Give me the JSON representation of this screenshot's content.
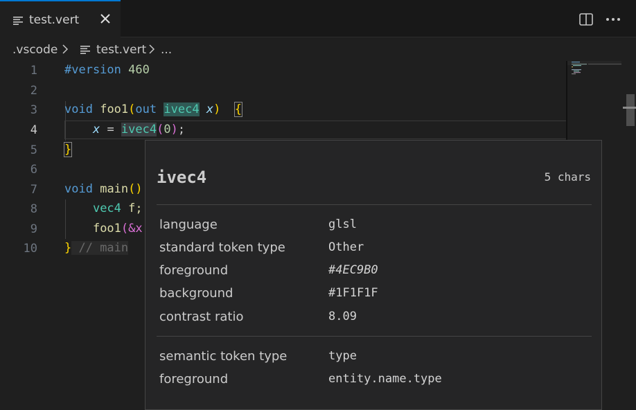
{
  "tab": {
    "label": "test.vert"
  },
  "breadcrumb": {
    "folder": ".vscode",
    "file": "test.vert",
    "more": "..."
  },
  "editor": {
    "active_line": 4,
    "lines": [
      {
        "num": "1"
      },
      {
        "num": "2"
      },
      {
        "num": "3"
      },
      {
        "num": "4"
      },
      {
        "num": "5"
      },
      {
        "num": "6"
      },
      {
        "num": "7"
      },
      {
        "num": "8"
      },
      {
        "num": "9"
      },
      {
        "num": "10"
      }
    ],
    "code": {
      "l1_directive": "#version",
      "l1_num": "460",
      "l3_void": "void",
      "l3_fn": "foo1",
      "l3_open": "(",
      "l3_out": "out",
      "l3_type": "ivec4",
      "l3_var": "x",
      "l3_close": ")",
      "l3_brace": "{",
      "l4_var": "x",
      "l4_eq": " = ",
      "l4_type": "ivec4",
      "l4_open": "(",
      "l4_num": "0",
      "l4_close": ")",
      "l4_semi": ";",
      "l5_brace": "}",
      "l7_void": "void",
      "l7_fn": "main",
      "l7_open": "()",
      "l8_type": "vec4",
      "l8_rest": " f;",
      "l9_fn": "foo1",
      "l9_rest": "(&x",
      "l10_brace": "}",
      "l10_comment": " // main"
    }
  },
  "hover": {
    "title": "ivec4",
    "chars": "5 chars",
    "section1": [
      {
        "key": "language",
        "value": "glsl"
      },
      {
        "key": "standard token type",
        "value": "Other"
      },
      {
        "key": "foreground",
        "value": "#4EC9B0"
      },
      {
        "key": "background",
        "value": "#1F1F1F"
      },
      {
        "key": "contrast ratio",
        "value": "8.09"
      }
    ],
    "section2": [
      {
        "key": "semantic token type",
        "value": "type"
      },
      {
        "key": "foreground",
        "value": "entity.name.type"
      }
    ]
  },
  "colors": {
    "accent": "#0078d4",
    "type": "#4EC9B0",
    "background": "#1F1F1F"
  }
}
